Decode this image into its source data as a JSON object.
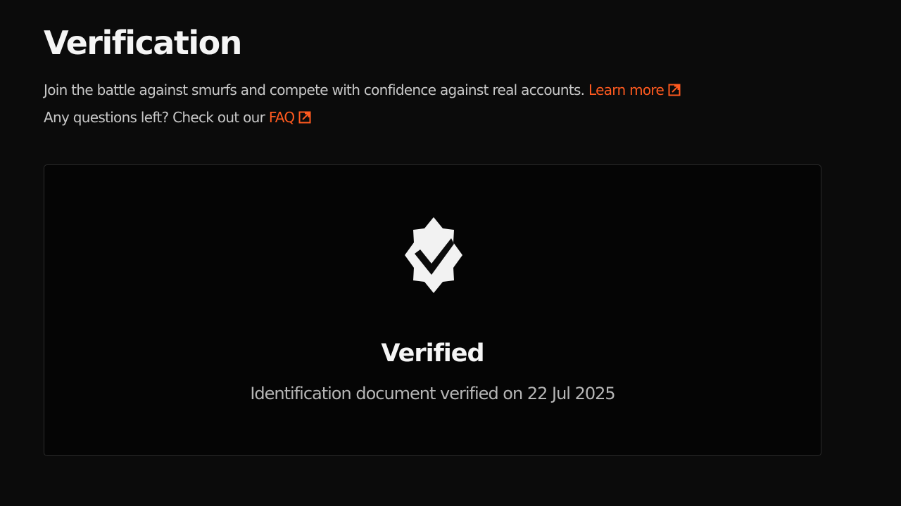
{
  "header": {
    "title": "Verification",
    "intro_text": "Join the battle against smurfs and compete with confidence against real accounts.",
    "learn_more_label": "Learn more",
    "questions_text": "Any questions left? Check out our",
    "faq_label": "FAQ"
  },
  "card": {
    "badge_icon": "verified-badge-icon",
    "status_title": "Verified",
    "status_detail": "Identification document verified on 22 Jul 2025"
  },
  "colors": {
    "background": "#0b0b0b",
    "accent": "#ff5a1f",
    "text_primary": "#f5f5f5",
    "text_secondary": "#c8c8c8"
  }
}
